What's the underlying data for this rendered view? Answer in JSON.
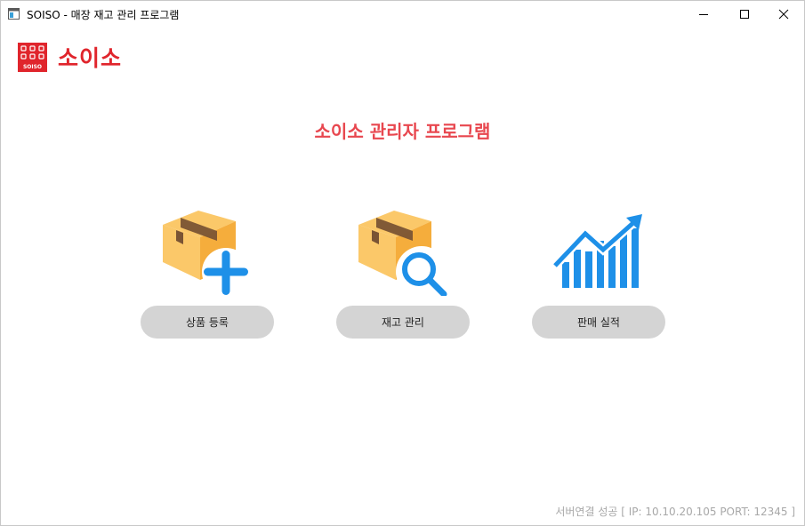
{
  "window": {
    "title": "SOISO - 매장 재고 관리 프로그램",
    "minimize_icon": "minimize-icon",
    "maximize_icon": "maximize-icon",
    "close_icon": "close-icon"
  },
  "logo": {
    "mark_text": "SOISO",
    "wordmark": "소이소",
    "brand_color": "#e0252c"
  },
  "page": {
    "title": "소이소 관리자 프로그램",
    "title_color": "#e8474f"
  },
  "menu": {
    "items": [
      {
        "label": "상품 등록",
        "icon": "box-add-icon"
      },
      {
        "label": "재고 관리",
        "icon": "box-search-icon"
      },
      {
        "label": "판매 실적",
        "icon": "sales-chart-icon"
      }
    ],
    "button_color": "#d4d4d4"
  },
  "status": {
    "text": "서버연결 성공  [ IP: 10.10.20.105 PORT: 12345 ]"
  },
  "colors": {
    "box_main": "#f5ad3c",
    "box_light": "#fbc869",
    "tape": "#7a5434",
    "accent_blue": "#1e90e8"
  }
}
